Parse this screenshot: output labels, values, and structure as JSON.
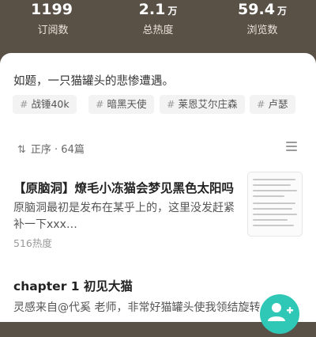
{
  "stats": [
    {
      "value": "1199",
      "unit": "",
      "label": "订阅数"
    },
    {
      "value": "2.1",
      "unit": "万",
      "label": "总热度"
    },
    {
      "value": "59.4",
      "unit": "万",
      "label": "浏览数"
    }
  ],
  "intro": "如题，一只猫罐头的悲惨遭遇。",
  "tags": [
    "战锤40k",
    "暗黑天使",
    "莱恩艾尔庄森",
    "卢瑟"
  ],
  "toc": {
    "sort_label": "正序 · 64篇"
  },
  "chapters": [
    {
      "title": "【原脑洞】燎毛小冻猫会梦见黑色太阳吗",
      "excerpt": "原脑洞最初是发布在某乎上的，这里没发赶紧补一下xxx…",
      "heat": "516热度"
    },
    {
      "title": "chapter 1 初见大猫",
      "excerpt": "灵感来自@代奚 老师，非常好猫罐头使我领结旋转"
    }
  ],
  "colors": {
    "header_bg": "#5a5146",
    "fab": "#2fc8b6"
  }
}
